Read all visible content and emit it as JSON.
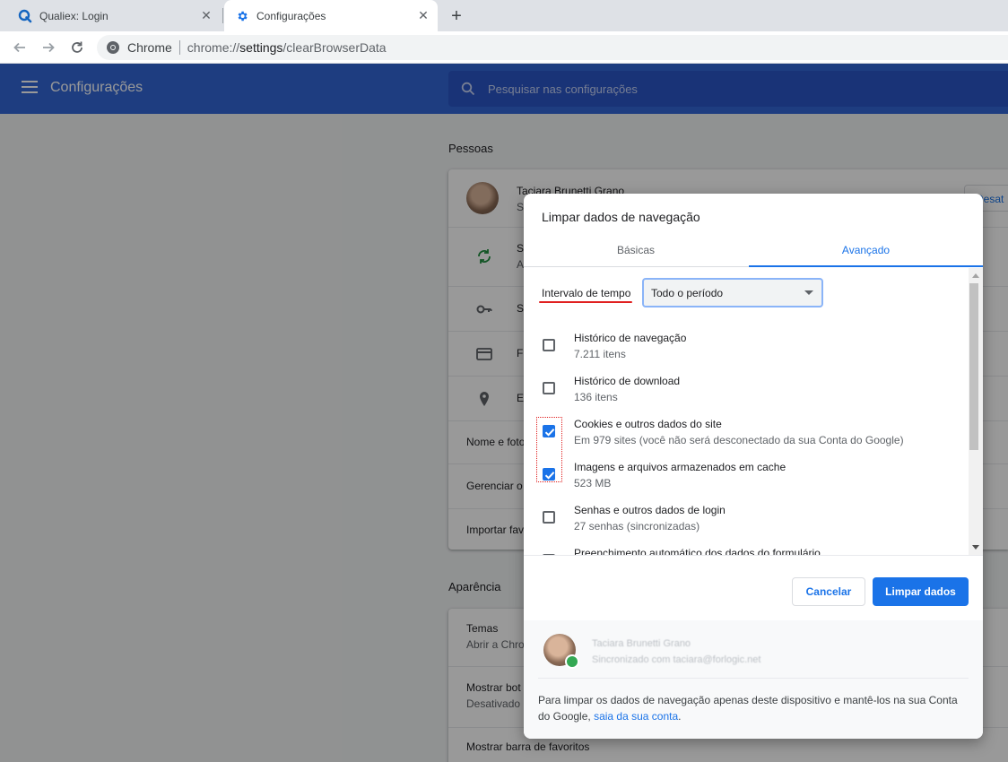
{
  "browser": {
    "tabs": [
      {
        "title": "Qualiex: Login",
        "favicon": "qualiex-q-icon",
        "active": false
      },
      {
        "title": "Configurações",
        "favicon": "gear-icon",
        "active": true
      }
    ],
    "omnibox": {
      "site_label": "Chrome",
      "url_prefix": "chrome://",
      "url_host": "settings",
      "url_path": "/clearBrowserData"
    }
  },
  "settings": {
    "header_title": "Configurações",
    "search_placeholder": "Pesquisar nas configurações",
    "section_people": "Pessoas",
    "profile_name": "Taciara Brunetti Grano",
    "profile_sub": "S",
    "signout_label": "Desat",
    "people_rows": [
      {
        "icon": "sync-icon",
        "title": "S",
        "sub": "A"
      },
      {
        "icon": "key-icon",
        "title": "S"
      },
      {
        "icon": "credit-card-icon",
        "title": "F"
      },
      {
        "icon": "location-pin-icon",
        "title": "E"
      }
    ],
    "text_rows": [
      "Nome e foto",
      "Gerenciar o",
      "Importar fav"
    ],
    "section_appearance": "Aparência",
    "appearance_rows": [
      {
        "title": "Temas",
        "sub": "Abrir a Chro"
      },
      {
        "title": "Mostrar bot",
        "sub": "Desativado"
      },
      {
        "title": "Mostrar barra de favoritos"
      }
    ]
  },
  "dialog": {
    "title": "Limpar dados de navegação",
    "tabs": [
      "Básicas",
      "Avançado"
    ],
    "active_tab": "Avançado",
    "time_range_label": "Intervalo de tempo",
    "time_range_value": "Todo o período",
    "items": [
      {
        "label": "Histórico de navegação",
        "desc": "7.211 itens",
        "checked": false
      },
      {
        "label": "Histórico de download",
        "desc": "136 itens",
        "checked": false
      },
      {
        "label": "Cookies e outros dados do site",
        "desc": "Em 979 sites (você não será desconectado da sua Conta do Google)",
        "checked": true
      },
      {
        "label": "Imagens e arquivos armazenados em cache",
        "desc": "523 MB",
        "checked": true
      },
      {
        "label": "Senhas e outros dados de login",
        "desc": "27 senhas (sincronizadas)",
        "checked": false
      },
      {
        "label": "Preenchimento automático dos dados do formulário",
        "desc": "",
        "checked": false
      }
    ],
    "cancel_label": "Cancelar",
    "clear_label": "Limpar dados",
    "account_name": "Taciara Brunetti Grano",
    "account_sub": "Sincronizado com taciara@forlogic.net",
    "footer_text": "Para limpar os dados de navegação apenas deste dispositivo e mantê-los na sua Conta do Google,",
    "footer_link": "saia da sua conta",
    "footer_end": ".",
    "accent_color": "#1a73e8"
  }
}
